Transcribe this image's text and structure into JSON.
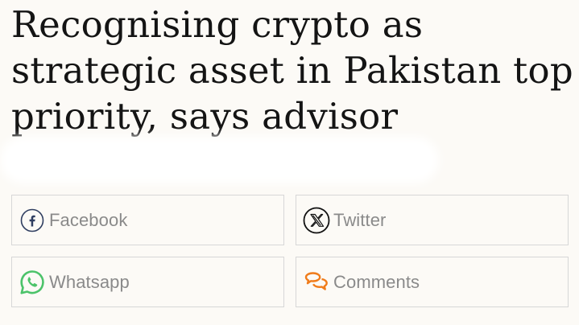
{
  "article": {
    "headline_lines": [
      "Recognising crypto as",
      "strategic asset in Pakistan top",
      "priority, says advisor"
    ]
  },
  "share": {
    "facebook": {
      "label": "Facebook",
      "icon": "facebook-icon",
      "color": "#3b5998"
    },
    "twitter": {
      "label": "Twitter",
      "icon": "x-twitter-icon",
      "color": "#000000"
    },
    "whatsapp": {
      "label": "Whatsapp",
      "icon": "whatsapp-icon",
      "color": "#25d366"
    },
    "comments": {
      "label": "Comments",
      "icon": "comments-icon",
      "color": "#f07c1b"
    }
  }
}
